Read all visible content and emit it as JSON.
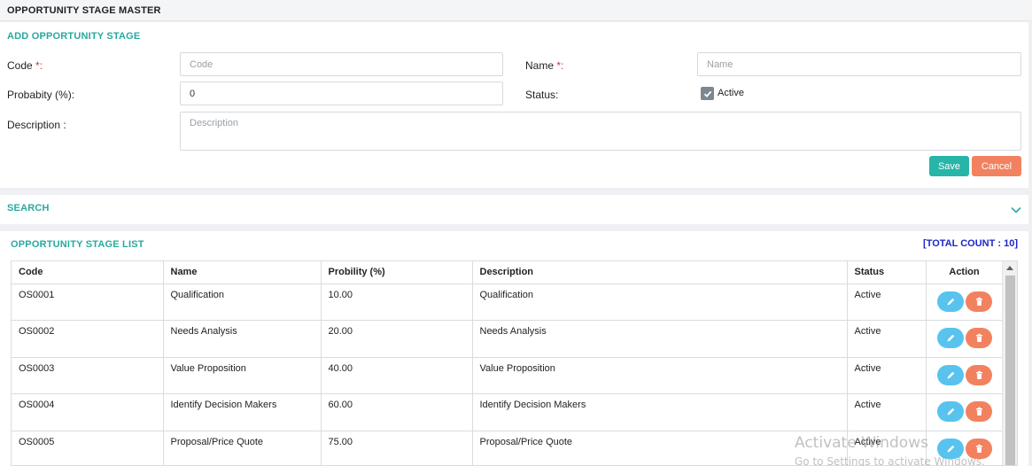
{
  "page": {
    "title": "OPPORTUNITY STAGE MASTER"
  },
  "add_form": {
    "heading": "ADD OPPORTUNITY STAGE",
    "code_label": "Code",
    "code_placeholder": "Code",
    "name_label": "Name",
    "name_placeholder": "Name",
    "required_marker": "*:",
    "probability_label": "Probabity (%):",
    "probability_value": "0",
    "status_label": "Status:",
    "active_label": "Active",
    "active_checked": true,
    "description_label": "Description :",
    "description_placeholder": "Description",
    "save_label": "Save",
    "cancel_label": "Cancel"
  },
  "search": {
    "heading": "SEARCH",
    "icon": "chevron-down-icon"
  },
  "list": {
    "heading": "OPPORTUNITY STAGE LIST",
    "total_count": "[TOTAL COUNT : 10]",
    "columns": [
      "Code",
      "Name",
      "Probility (%)",
      "Description",
      "Status",
      "Action"
    ],
    "rows": [
      {
        "code": "OS0001",
        "name": "Qualification",
        "probability": "10.00",
        "description": "Qualification",
        "status": "Active"
      },
      {
        "code": "OS0002",
        "name": "Needs Analysis",
        "probability": "20.00",
        "description": "Needs Analysis",
        "status": "Active"
      },
      {
        "code": "OS0003",
        "name": "Value Proposition",
        "probability": "40.00",
        "description": "Value Proposition",
        "status": "Active"
      },
      {
        "code": "OS0004",
        "name": "Identify Decision Makers",
        "probability": "60.00",
        "description": "Identify Decision Makers",
        "status": "Active"
      },
      {
        "code": "OS0005",
        "name": "Proposal/Price Quote",
        "probability": "75.00",
        "description": "Proposal/Price Quote",
        "status": "Active"
      }
    ]
  },
  "watermark": {
    "line1": "Activate Windows",
    "line2": "Go to Settings to activate Windows."
  },
  "colors": {
    "teal": "#27aaa0",
    "save": "#27b5a8",
    "cancel": "#f2825f",
    "edit": "#58c3ee",
    "count": "#1b27c4"
  }
}
